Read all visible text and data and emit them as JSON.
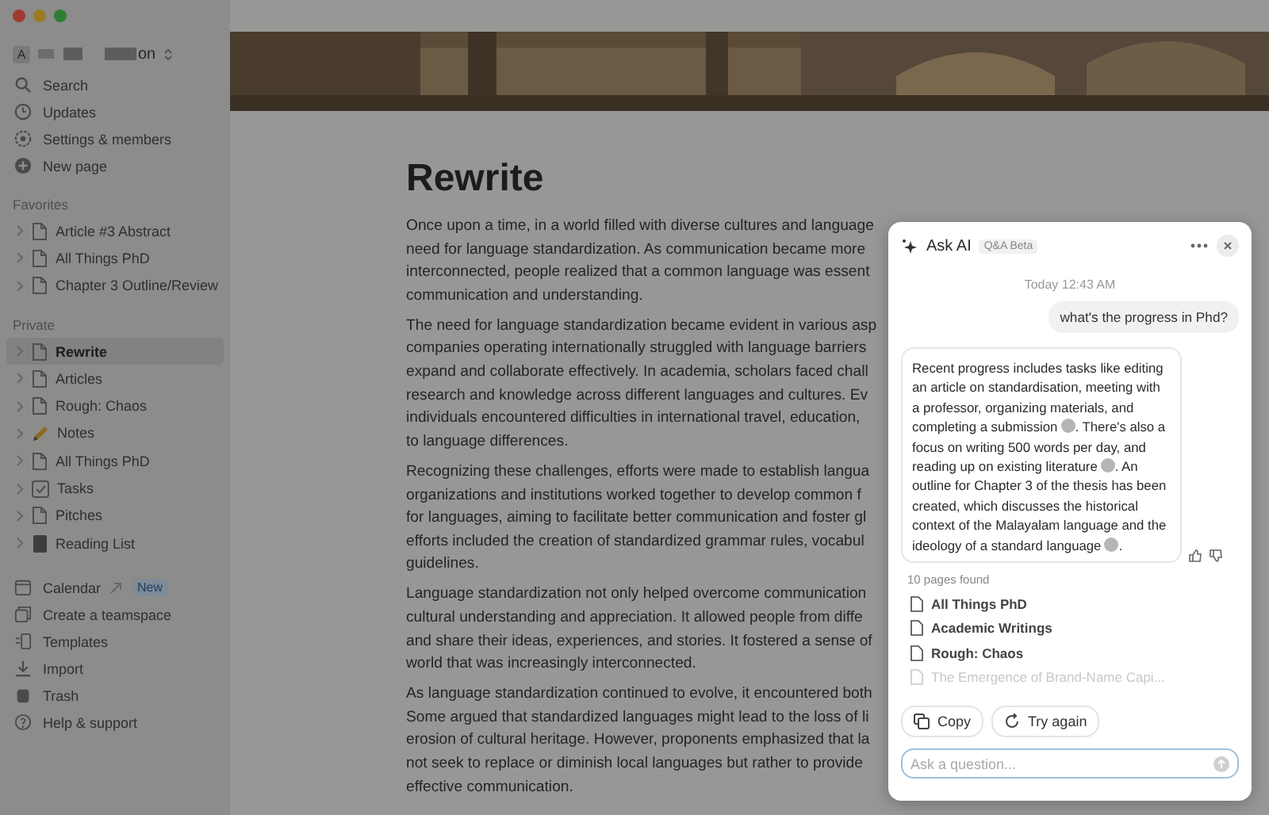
{
  "sidebar": {
    "workspace": {
      "avatar": "A",
      "name_end": "on"
    },
    "actions": [
      {
        "label": "Search",
        "kind": "search"
      },
      {
        "label": "Updates",
        "kind": "clock"
      },
      {
        "label": "Settings & members",
        "kind": "gear"
      },
      {
        "label": "New page",
        "kind": "plus"
      }
    ],
    "favorites": {
      "title": "Favorites",
      "items": [
        {
          "label": "Article #3 Abstract",
          "kind": "page",
          "selected": false
        },
        {
          "label": "All Things PhD",
          "kind": "page",
          "selected": false
        },
        {
          "label": "Chapter 3 Outline/Review",
          "kind": "page",
          "selected": false
        }
      ]
    },
    "private": {
      "title": "Private",
      "items": [
        {
          "label": "Rewrite",
          "kind": "page",
          "selected": true
        },
        {
          "label": "Articles",
          "kind": "page",
          "selected": false
        },
        {
          "label": "Rough: Chaos",
          "kind": "page",
          "selected": false
        },
        {
          "label": "Notes",
          "kind": "pencil",
          "selected": false
        },
        {
          "label": "All Things PhD",
          "kind": "page",
          "selected": false
        },
        {
          "label": "Tasks",
          "kind": "check",
          "selected": false
        },
        {
          "label": "Pitches",
          "kind": "page",
          "selected": false
        },
        {
          "label": "Reading List",
          "kind": "book",
          "selected": false
        }
      ]
    },
    "footer": [
      {
        "label": "Calendar",
        "kind": "calendar",
        "badge": "New"
      },
      {
        "label": "Create a teamspace",
        "kind": "team"
      },
      {
        "label": "Templates",
        "kind": "templates"
      },
      {
        "label": "Import",
        "kind": "import"
      },
      {
        "label": "Trash",
        "kind": "trash"
      },
      {
        "label": "Help & support",
        "kind": "help"
      }
    ]
  },
  "page": {
    "title": "Rewrite",
    "paragraphs": [
      [
        "Once upon a time, in a world filled with diverse cultures and language",
        "need for language standardization. As communication became more",
        "interconnected, people realized that a common language was essent",
        "communication and understanding."
      ],
      [
        "The need for language standardization became evident in various asp",
        "companies operating internationally struggled with language barriers",
        "expand and collaborate effectively. In academia, scholars faced chall",
        "research and knowledge across different languages and cultures. Ev",
        "individuals encountered difficulties in international travel, education,",
        "to language differences."
      ],
      [
        "Recognizing these challenges, efforts were made to establish langua",
        "organizations and institutions worked together to develop common f",
        "for languages, aiming to facilitate better communication and foster gl",
        "efforts included the creation of standardized grammar rules, vocabul",
        "guidelines."
      ],
      [
        "Language standardization not only helped overcome communication",
        "cultural understanding and appreciation. It allowed people from diffe",
        "and share their ideas, experiences, and stories. It fostered a sense of",
        "world that was increasingly interconnected."
      ],
      [
        "As language standardization continued to evolve, it encountered both",
        "Some argued that standardized languages might lead to the loss of li",
        "erosion of cultural heritage. However, proponents emphasized that la",
        "not seek to replace or diminish local languages but rather to provide",
        "effective communication."
      ]
    ]
  },
  "ask_ai": {
    "title": "Ask AI",
    "badge": "Q&A Beta",
    "timestamp": "Today 12:43 AM",
    "question": "what's the progress in Phd?",
    "answer": [
      {
        "kind": "text",
        "text": "Recent progress includes tasks like editing an article on standardisation, meeting with a professor, organizing materials, and completing a submission"
      },
      {
        "kind": "citation"
      },
      {
        "kind": "text",
        "text": ". There's also a focus on writing 500 words per day, and reading up on existing literature"
      },
      {
        "kind": "citation"
      },
      {
        "kind": "text",
        "text": ". An outline for Chapter 3 of the thesis has been created, which discusses the historical context of the Malayalam language and the ideology of a standard language"
      },
      {
        "kind": "citation"
      },
      {
        "kind": "text",
        "text": "."
      }
    ],
    "sources_count": "10 pages found",
    "sources": [
      {
        "label": "All Things PhD",
        "faded": false
      },
      {
        "label": "Academic Writings",
        "faded": false
      },
      {
        "label": "Rough: Chaos",
        "faded": false
      },
      {
        "label": "The Emergence of Brand-Name Capi...",
        "faded": true
      }
    ],
    "buttons": [
      {
        "label": "Copy",
        "kind": "copy"
      },
      {
        "label": "Try again",
        "kind": "retry"
      }
    ],
    "input": {
      "placeholder": "Ask a question..."
    }
  }
}
